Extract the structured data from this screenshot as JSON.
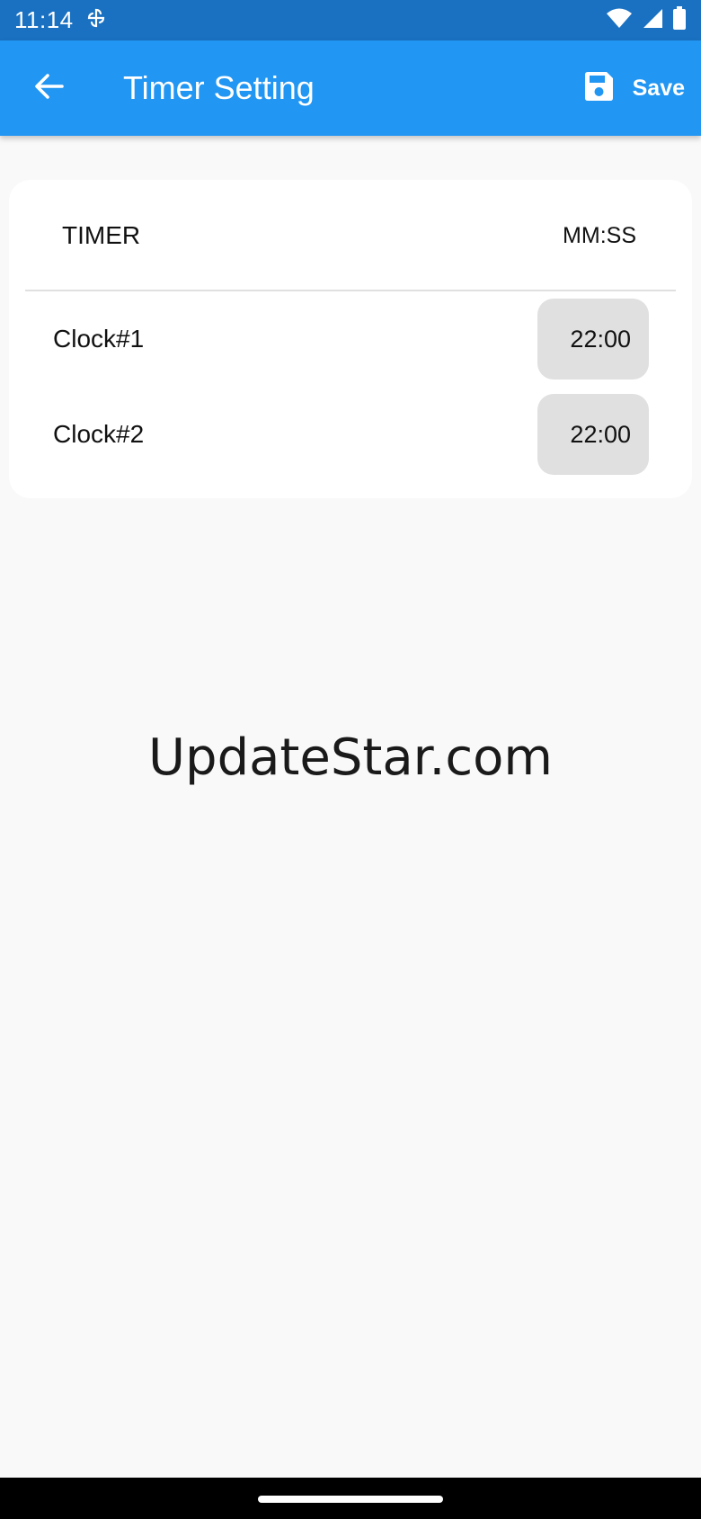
{
  "status_bar": {
    "time": "11:14",
    "notification_icon": "pinwheel-icon",
    "icons": [
      "wifi-icon",
      "cell-signal-icon",
      "battery-icon"
    ]
  },
  "app_bar": {
    "title": "Timer Setting",
    "save_label": "Save",
    "back_icon": "arrow-left-icon",
    "save_icon": "floppy-disk-icon",
    "color": "#2196f3"
  },
  "timer_card": {
    "header_label": "TIMER",
    "unit_label": "MM:SS",
    "clocks": [
      {
        "label": "Clock#1",
        "value": "22:00"
      },
      {
        "label": "Clock#2",
        "value": "22:00"
      }
    ]
  },
  "watermark": "UpdateStar.com"
}
